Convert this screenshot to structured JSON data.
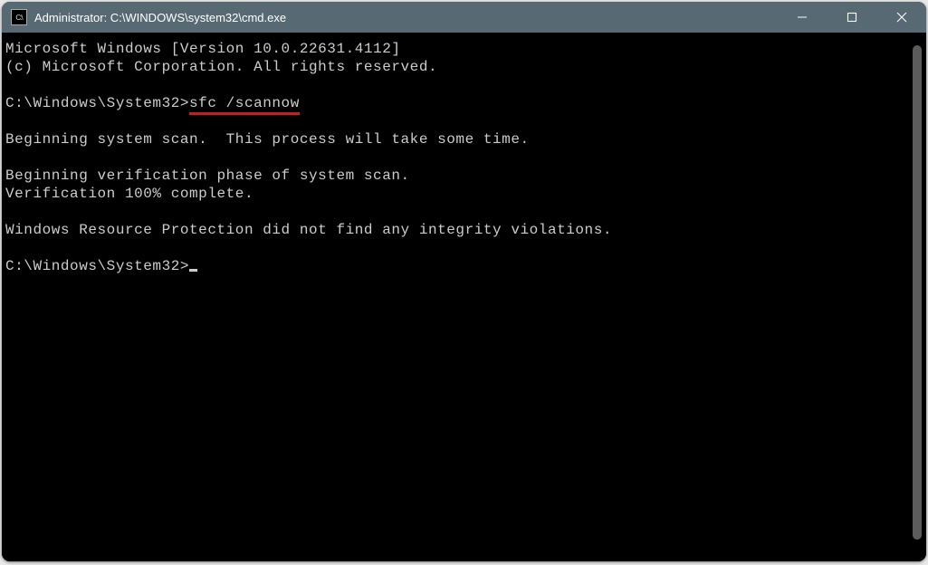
{
  "titlebar": {
    "title": "Administrator: C:\\WINDOWS\\system32\\cmd.exe"
  },
  "terminal": {
    "banner1": "Microsoft Windows [Version 10.0.22631.4112]",
    "banner2": "(c) Microsoft Corporation. All rights reserved.",
    "blank": "",
    "prompt1_pre": "C:\\Windows\\System32>",
    "prompt1_cmd": "sfc /scannow",
    "l1": "Beginning system scan.  This process will take some time.",
    "l2": "Beginning verification phase of system scan.",
    "l3": "Verification 100% complete.",
    "l4": "Windows Resource Protection did not find any integrity violations.",
    "prompt2": "C:\\Windows\\System32>"
  }
}
